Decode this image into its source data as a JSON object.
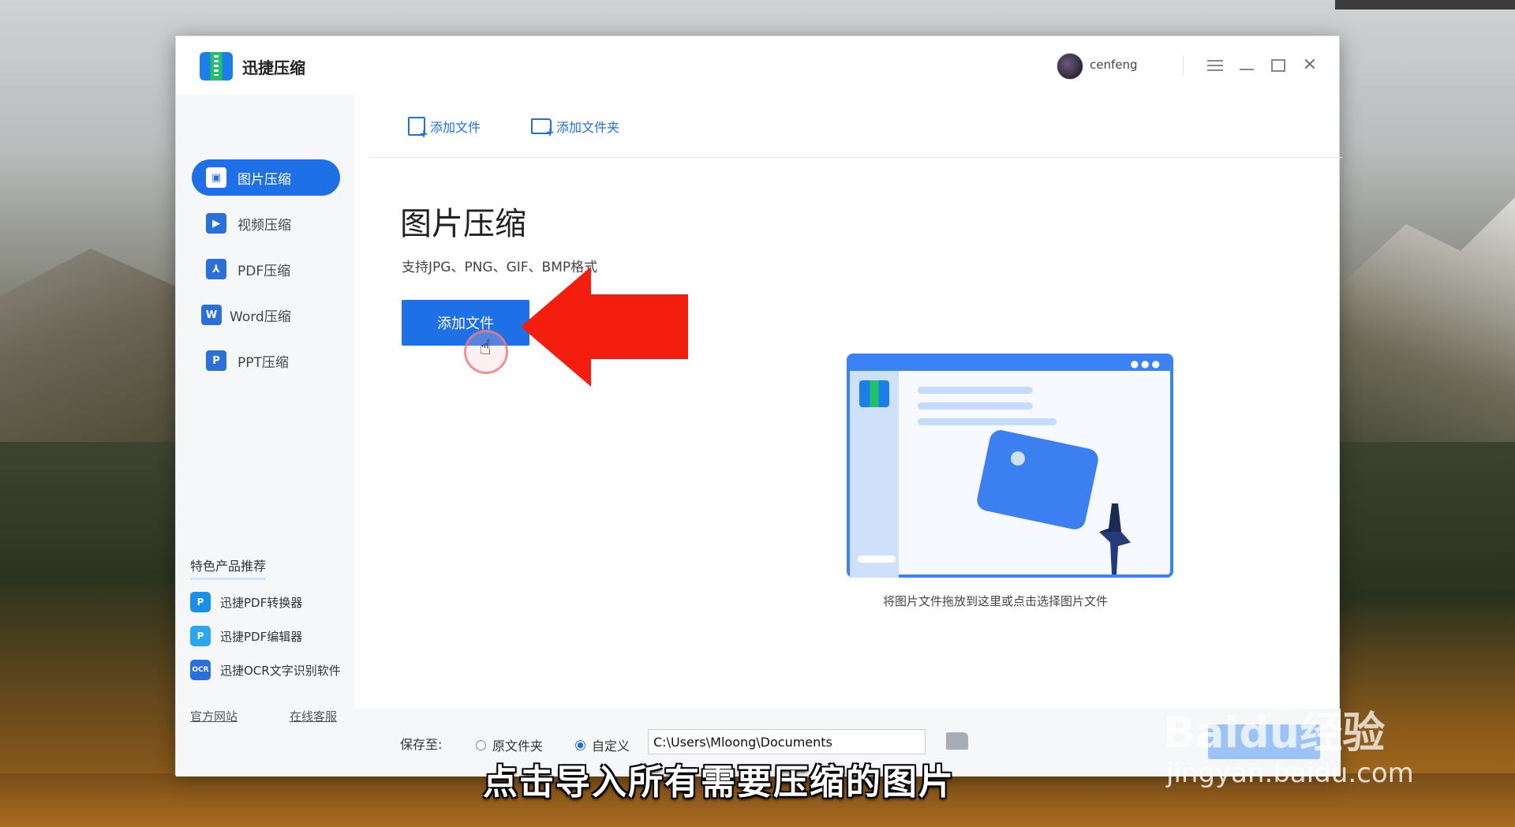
{
  "app": {
    "title": "迅捷压缩",
    "username": "cenfeng"
  },
  "toolbar": {
    "add_file": "添加文件",
    "add_folder": "添加文件夹"
  },
  "sidebar": {
    "items": [
      {
        "label": "图片压缩",
        "icon": "image-compress-icon",
        "active": true
      },
      {
        "label": "视频压缩",
        "icon": "video-compress-icon",
        "active": false
      },
      {
        "label": "PDF压缩",
        "icon": "pdf-compress-icon",
        "active": false
      },
      {
        "label": "Word压缩",
        "icon": "word-compress-icon",
        "active": false
      },
      {
        "label": "PPT压缩",
        "icon": "ppt-compress-icon",
        "active": false
      }
    ],
    "promo_title": "特色产品推荐",
    "promos": [
      {
        "label": "迅捷PDF转换器",
        "icon": "pdf-converter-icon"
      },
      {
        "label": "迅捷PDF编辑器",
        "icon": "pdf-editor-icon"
      },
      {
        "label": "迅捷OCR文字识别软件",
        "icon": "ocr-icon"
      }
    ],
    "footer": {
      "website": "官方网站",
      "support": "在线客服"
    }
  },
  "main": {
    "title": "图片压缩",
    "subtitle": "支持JPG、PNG、GIF、BMP格式",
    "add_button": "添加文件",
    "drop_hint": "将图片文件拖放到这里或点击选择图片文件"
  },
  "bottom": {
    "save_to": "保存至:",
    "option_original": "原文件夹",
    "option_custom": "自定义",
    "selected_option": "自定义",
    "path": "C:\\Users\\Mloong\\Documents"
  },
  "overlay": {
    "subtitle": "点击导入所有需要压缩的图片",
    "watermark": "Baidu经验",
    "watermark_url": "jingyan.baidu.com"
  },
  "colors": {
    "accent": "#1f6fe6",
    "arrow": "#f41e0e"
  }
}
